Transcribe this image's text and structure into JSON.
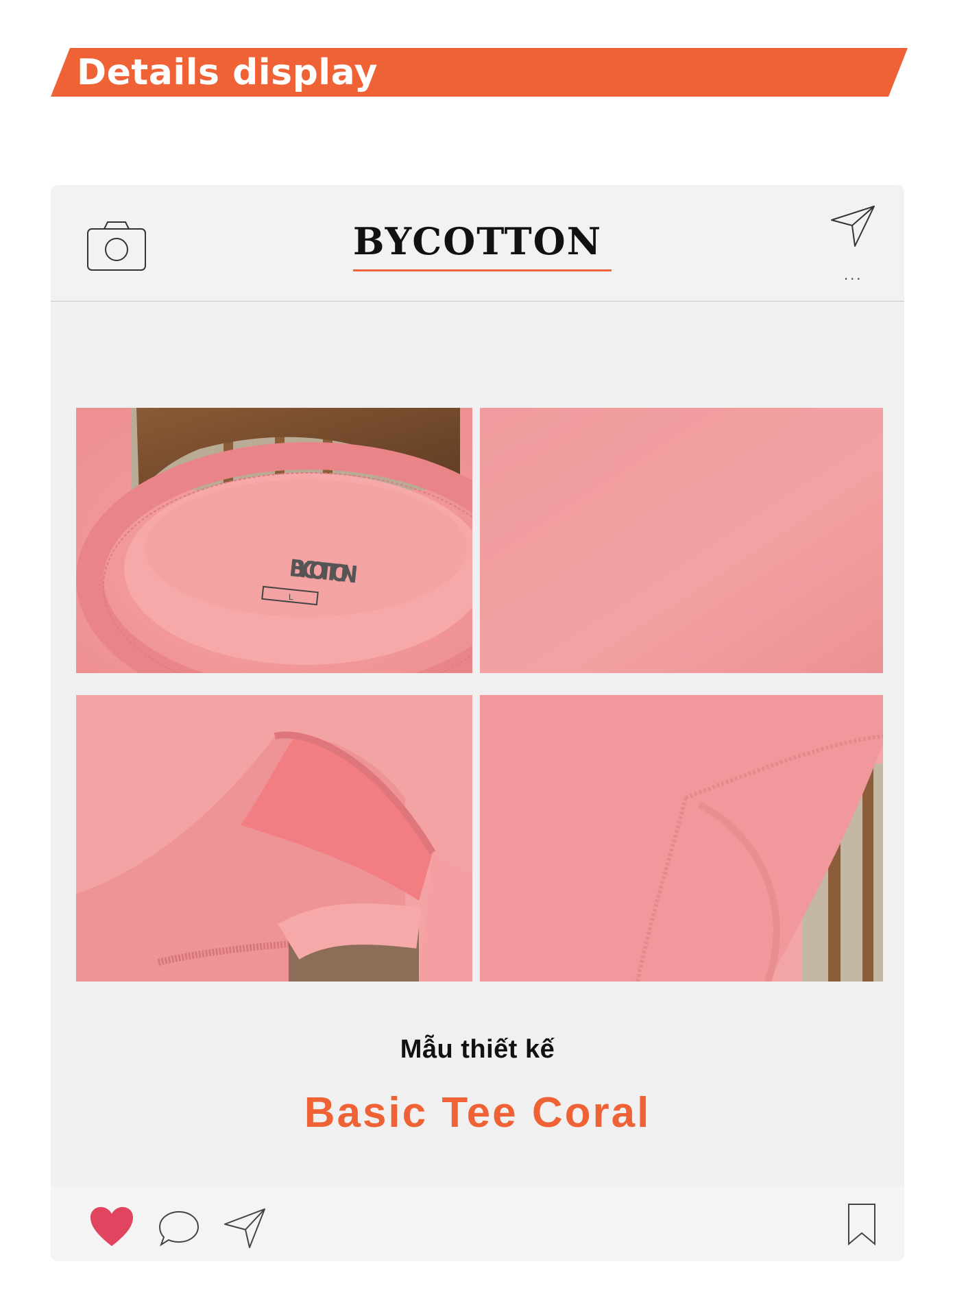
{
  "banner": {
    "title": "Details display",
    "color": "#ee6236"
  },
  "card": {
    "brand": "BYCOTTON",
    "header_icons": [
      "camera-icon",
      "send-icon",
      "more-icon"
    ],
    "more_label": "...",
    "photos": [
      {
        "label_brand": "BYCOTTON",
        "label_size": "L"
      },
      {},
      {},
      {}
    ],
    "caption": {
      "subtitle": "Mẫu thiết kế",
      "title": "Basic Tee Coral"
    },
    "footer_icons": [
      "heart-icon",
      "comment-icon",
      "share-icon",
      "bookmark-icon"
    ]
  },
  "colors": {
    "accent": "#ee6236",
    "fabric": "#f0979a",
    "heart": "#e0445f"
  }
}
